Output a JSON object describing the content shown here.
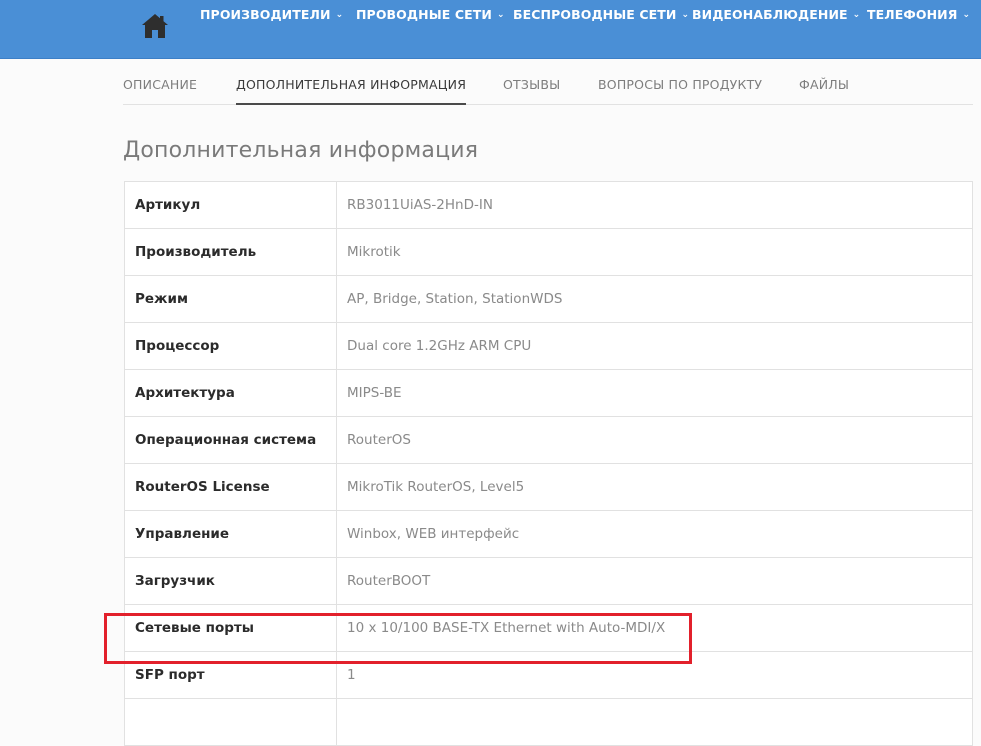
{
  "nav": {
    "home_icon": "home-icon",
    "items": [
      {
        "label": "ПРОИЗВОДИТЕЛИ"
      },
      {
        "label": "ПРОВОДНЫЕ СЕТИ"
      },
      {
        "label": "БЕСПРОВОДНЫЕ СЕТИ"
      },
      {
        "label": "ВИДЕОНАБЛЮДЕНИЕ"
      },
      {
        "label": "ТЕЛЕФОНИЯ"
      }
    ],
    "chevron": "⌄"
  },
  "tabs": [
    {
      "label": "ОПИСАНИЕ",
      "active": false
    },
    {
      "label": "ДОПОЛНИТЕЛЬНАЯ ИНФОРМАЦИЯ",
      "active": true
    },
    {
      "label": "ОТЗЫВЫ",
      "active": false
    },
    {
      "label": "ВОПРОСЫ ПО ПРОДУКТУ",
      "active": false
    },
    {
      "label": "ФАЙЛЫ",
      "active": false
    }
  ],
  "section_title": "Дополнительная информация",
  "specs": [
    {
      "key": "Артикул",
      "value": "RB3011UiAS-2HnD-IN"
    },
    {
      "key": "Производитель",
      "value": "Mikrotik"
    },
    {
      "key": "Режим",
      "value": "AP, Bridge, Station, StationWDS"
    },
    {
      "key": "Процессор",
      "value": "Dual core 1.2GHz ARM CPU"
    },
    {
      "key": "Архитектура",
      "value": "MIPS-BE"
    },
    {
      "key": "Операционная система",
      "value": "RouterOS"
    },
    {
      "key": "RouterOS License",
      "value": "MikroTik RouterOS, Level5"
    },
    {
      "key": "Управление",
      "value": "Winbox, WEB интерфейс"
    },
    {
      "key": "Загрузчик",
      "value": "RouterBOOT"
    },
    {
      "key": "Сетевые порты",
      "value": "10 x 10/100 BASE-TX Ethernet with Auto-MDI/X"
    },
    {
      "key": "SFP порт",
      "value": "1"
    },
    {
      "key": "",
      "value": ""
    }
  ],
  "colors": {
    "topbar": "#4a8fd6",
    "highlight": "#e2202b"
  }
}
